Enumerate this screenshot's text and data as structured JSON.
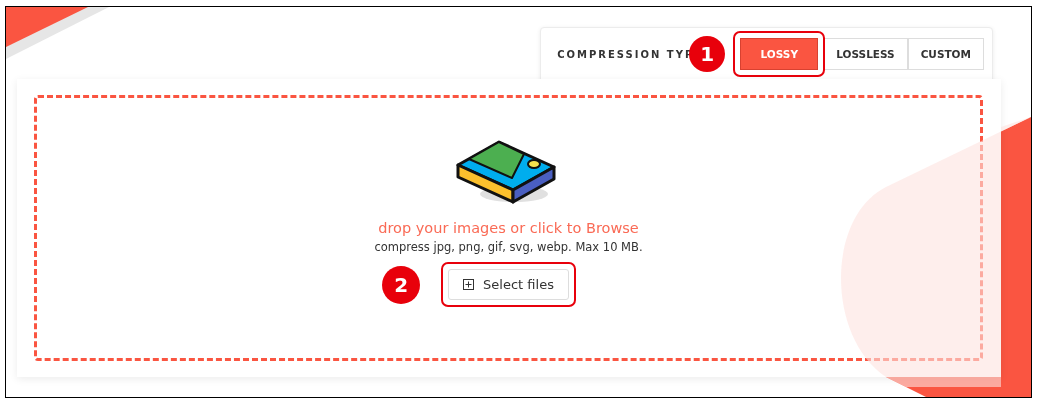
{
  "compression": {
    "label": "COMPRESSION TYP",
    "options": [
      {
        "label": "LOSSY",
        "selected": true,
        "callout": "1"
      },
      {
        "label": "LOSSLESS",
        "selected": false
      },
      {
        "label": "CUSTOM",
        "selected": false
      }
    ]
  },
  "dropzone": {
    "title": "drop your images or click to Browse",
    "subtitle": "compress jpg, png, gif, svg, webp. Max 10 MB.",
    "button": {
      "label": "Select files",
      "callout": "2"
    }
  }
}
